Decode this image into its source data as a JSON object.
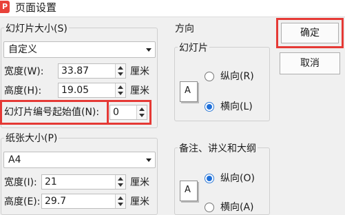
{
  "window": {
    "title": "页面设置",
    "logo": "P"
  },
  "slide_size": {
    "group_title": "幻灯片大小(S)",
    "preset": "自定义",
    "width_label": "宽度(W):",
    "width_value": "33.87",
    "height_label": "高度(H):",
    "height_value": "19.05",
    "unit": "厘米",
    "start_number_label": "幻灯片编号起始值(N):",
    "start_number_value": "0"
  },
  "paper_size": {
    "group_title": "纸张大小(P)",
    "preset": "A4",
    "width_label": "宽度(I):",
    "width_value": "21",
    "height_label": "高度(E):",
    "height_value": "29.7",
    "unit": "厘米"
  },
  "orientation": {
    "group_title": "方向",
    "slides": {
      "title": "幻灯片",
      "portrait": "纵向(R)",
      "landscape": "横向(L)",
      "selected": "横向(L)"
    },
    "notes": {
      "title": "备注、讲义和大纲",
      "portrait": "纵向(O)",
      "landscape": "横向(A)",
      "selected": "纵向(O)"
    },
    "page_icon_letter": "A"
  },
  "buttons": {
    "ok": "确定",
    "cancel": "取消"
  },
  "colors": {
    "highlight": "#e53935",
    "radio_selected": "#1e6fd9"
  },
  "icons": [
    "app-logo-icon",
    "dropdown-arrow-icon",
    "spin-up-icon",
    "spin-down-icon",
    "page-orientation-icon"
  ]
}
